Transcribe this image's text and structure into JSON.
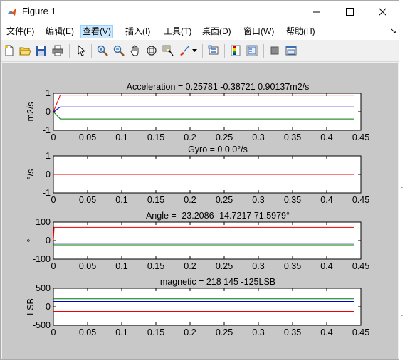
{
  "window": {
    "title": "Figure 1"
  },
  "menu": [
    "文件(F)",
    "编辑(E)",
    "查看(V)",
    "插入(I)",
    "工具(T)",
    "桌面(D)",
    "窗口(W)",
    "帮助(H)"
  ],
  "menu_arrow": "↘",
  "toolbar_icons": [
    "new-figure-icon",
    "open-file-icon",
    "save-icon",
    "print-icon",
    "edit-plot-arrow-icon",
    "zoom-in-icon",
    "zoom-out-icon",
    "pan-hand-icon",
    "rotate-3d-icon",
    "data-cursor-icon",
    "brush-icon",
    "brush-dropdown-icon",
    "link-plot-icon",
    "colorbar-icon",
    "legend-icon",
    "hide-plot-tools-icon",
    "show-plot-tools-icon"
  ],
  "colors": {
    "red": "#ee0000",
    "blue": "#0000cc",
    "green": "#007a00",
    "figure_bg": "#c8c8c8"
  },
  "edge_marks": [
    "-",
    "-"
  ],
  "chart_data": [
    {
      "type": "line",
      "title": "Acceleration = 0.25781    -0.38721     0.90137m2/s",
      "ylabel": "m2/s",
      "ylim": [
        -1,
        1
      ],
      "yticks": [
        "1",
        "0",
        "-1"
      ],
      "xlim": [
        0,
        0.45
      ],
      "xticks": [
        "0",
        "0.05",
        "0.1",
        "0.15",
        "0.2",
        "0.25",
        "0.3",
        "0.35",
        "0.4",
        "0.45"
      ],
      "series": [
        {
          "color": "red",
          "x": [
            0,
            0.01,
            0.44
          ],
          "y": [
            0,
            0.90137,
            0.90137
          ]
        },
        {
          "color": "blue",
          "x": [
            0,
            0.01,
            0.44
          ],
          "y": [
            0,
            0.25781,
            0.25781
          ]
        },
        {
          "color": "green",
          "x": [
            0,
            0.01,
            0.44
          ],
          "y": [
            0,
            -0.38721,
            -0.38721
          ]
        }
      ]
    },
    {
      "type": "line",
      "title": "Gyro = 0  0  0°/s",
      "ylabel": "°/s",
      "ylim": [
        -1,
        1
      ],
      "yticks": [
        "1",
        "0",
        "-1"
      ],
      "xlim": [
        0,
        0.45
      ],
      "xticks": [
        "0",
        "0.05",
        "0.1",
        "0.15",
        "0.2",
        "0.25",
        "0.3",
        "0.35",
        "0.4",
        "0.45"
      ],
      "series": [
        {
          "color": "blue",
          "x": [
            0,
            0.44
          ],
          "y": [
            0,
            0
          ]
        },
        {
          "color": "green",
          "x": [
            0,
            0.44
          ],
          "y": [
            0,
            0
          ]
        },
        {
          "color": "red",
          "x": [
            0,
            0.44
          ],
          "y": [
            0,
            0
          ]
        }
      ]
    },
    {
      "type": "line",
      "title": "Angle = -23.2086      -14.7217      71.5979°",
      "ylabel": "°",
      "ylim": [
        -100,
        100
      ],
      "yticks": [
        "100",
        "0",
        "-100"
      ],
      "xlim": [
        0,
        0.45
      ],
      "xticks": [
        "0",
        "0.05",
        "0.1",
        "0.15",
        "0.2",
        "0.25",
        "0.3",
        "0.35",
        "0.4",
        "0.45"
      ],
      "series": [
        {
          "color": "red",
          "x": [
            0,
            0.001,
            0.44
          ],
          "y": [
            0,
            71.5979,
            71.5979
          ]
        },
        {
          "color": "blue",
          "x": [
            0,
            0.44
          ],
          "y": [
            -14.7217,
            -14.7217
          ]
        },
        {
          "color": "green",
          "x": [
            0,
            0.44
          ],
          "y": [
            -23.2086,
            -23.2086
          ]
        }
      ]
    },
    {
      "type": "line",
      "title": "magnetic = 218  145 -125LSB",
      "ylabel": "LSB",
      "ylim": [
        -500,
        500
      ],
      "yticks": [
        "500",
        "0",
        "-500"
      ],
      "xlim": [
        0,
        0.45
      ],
      "xticks": [
        "0",
        "0.05",
        "0.1",
        "0.15",
        "0.2",
        "0.25",
        "0.3",
        "0.35",
        "0.4",
        "0.45"
      ],
      "series": [
        {
          "color": "green",
          "x": [
            0,
            0.44
          ],
          "y": [
            218,
            218
          ]
        },
        {
          "color": "blue",
          "x": [
            0,
            0.44
          ],
          "y": [
            145,
            145
          ]
        },
        {
          "color": "red",
          "x": [
            0,
            0.44
          ],
          "y": [
            -125,
            -125
          ]
        }
      ]
    }
  ]
}
